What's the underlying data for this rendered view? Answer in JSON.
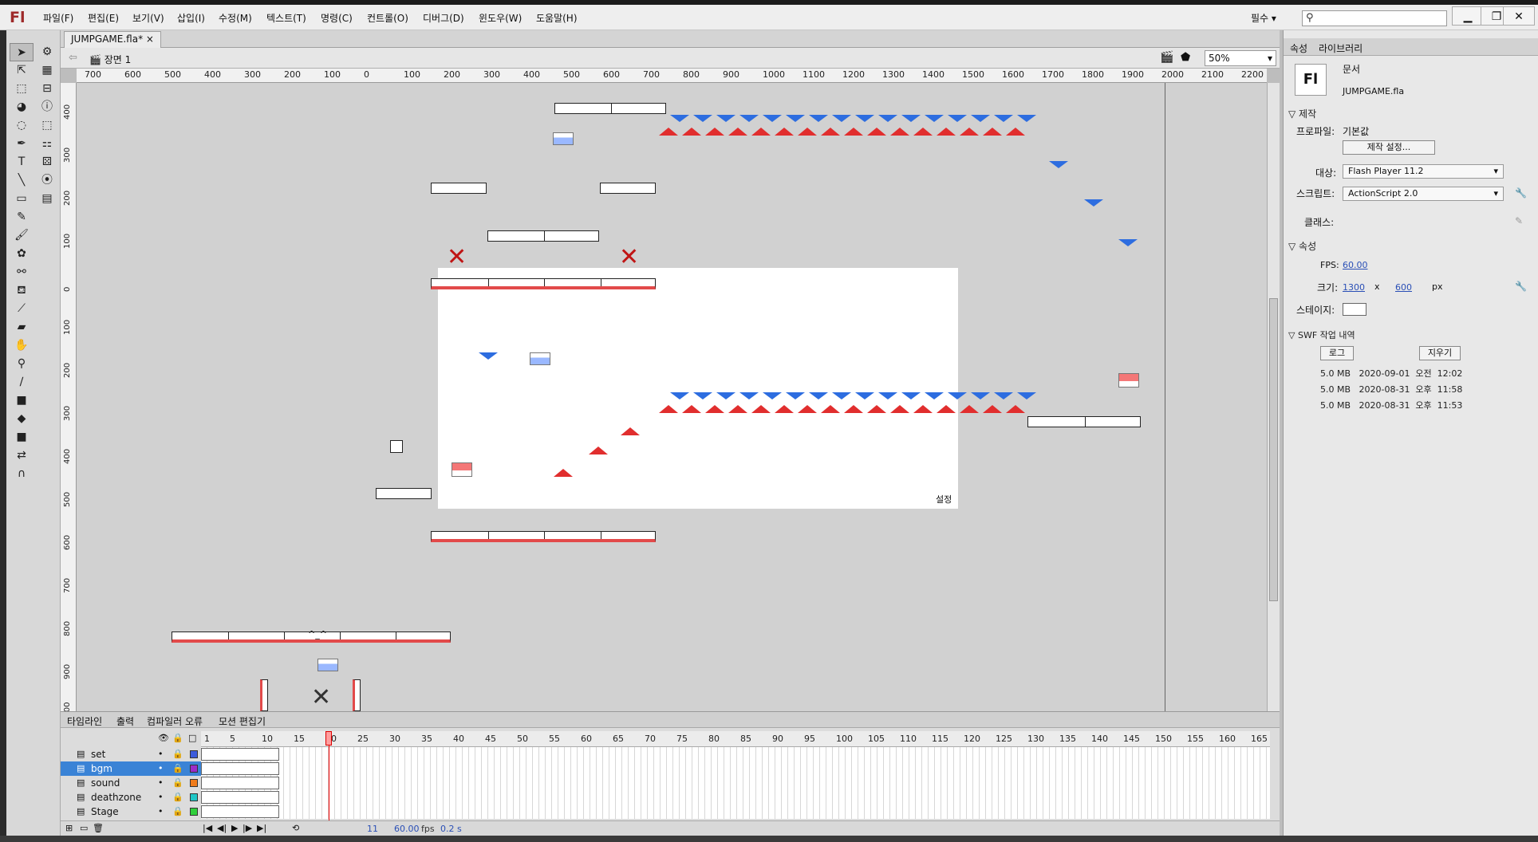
{
  "app": {
    "logo": "Fl"
  },
  "menu": [
    "파일(F)",
    "편집(E)",
    "보기(V)",
    "삽입(I)",
    "수정(M)",
    "텍스트(T)",
    "명령(C)",
    "컨트롤(O)",
    "디버그(D)",
    "윈도우(W)",
    "도움말(H)"
  ],
  "workspace_preset": "필수 ▾",
  "window_buttons": [
    "▁",
    "❐",
    "✕"
  ],
  "document": {
    "tab": "JUMPGAME.fla*",
    "tab_close": "×",
    "scene": "장면 1",
    "zoom": "50%"
  },
  "ruler_h": [
    "700",
    "600",
    "500",
    "400",
    "300",
    "200",
    "100",
    "0",
    "100",
    "200",
    "300",
    "400",
    "500",
    "600",
    "700",
    "800",
    "900",
    "1000",
    "1100",
    "1200",
    "1300",
    "1400",
    "1500",
    "1600",
    "1700",
    "1800",
    "1900",
    "2000",
    "2100",
    "2200"
  ],
  "ruler_v": [
    "400",
    "300",
    "200",
    "100",
    "0",
    "100",
    "200",
    "300",
    "400",
    "500",
    "600",
    "700",
    "800",
    "900",
    "1000"
  ],
  "stage_label": "설정",
  "smile_label": "^_^",
  "timeline": {
    "tabs": [
      "타임라인",
      "출력",
      "컴파일러 오류",
      "모션 편집기"
    ],
    "frame_numbers": [
      "1",
      "5",
      "10",
      "15",
      "20",
      "25",
      "30",
      "35",
      "40",
      "45",
      "50",
      "55",
      "60",
      "65",
      "70",
      "75",
      "80",
      "85",
      "90",
      "95",
      "100",
      "105",
      "110",
      "115",
      "120",
      "125",
      "130",
      "135",
      "140",
      "145",
      "150",
      "155",
      "160",
      "165"
    ],
    "layers": [
      {
        "name": "set",
        "color": "#3b5bdb",
        "selected": false
      },
      {
        "name": "bgm",
        "color": "#9b2cc9",
        "selected": true
      },
      {
        "name": "sound",
        "color": "#f07b1a",
        "selected": false
      },
      {
        "name": "deathzone",
        "color": "#1fc6c6",
        "selected": false
      },
      {
        "name": "Stage",
        "color": "#2fcf3b",
        "selected": false
      }
    ],
    "current_frame": "11",
    "fps": "60.00",
    "fps_unit": "fps",
    "time": "0.2 s"
  },
  "properties": {
    "tabs": [
      "속성",
      "라이브러리"
    ],
    "doc_icon": "Fl",
    "doc_type": "문서",
    "doc_file": "JUMPGAME.fla",
    "publish": {
      "section": "제작",
      "profile_label": "프로파일:",
      "profile_value": "기본값",
      "settings_button": "제작 설정...",
      "target_label": "대상:",
      "target_value": "Flash Player 11.2",
      "script_label": "스크립트:",
      "script_value": "ActionScript 2.0",
      "class_label": "클래스:"
    },
    "props": {
      "section": "속성",
      "fps_label": "FPS:",
      "fps_value": "60.00",
      "size_label": "크기:",
      "width": "1300",
      "x": "x",
      "height": "600",
      "unit": "px",
      "stage_label": "스테이지:"
    },
    "swf_history": {
      "section": "SWF 작업 내역",
      "log_button": "로그",
      "clear_button": "지우기",
      "entries": [
        "5.0 MB   2020-09-01  오전  12:02",
        "5.0 MB   2020-08-31  오후  11:58",
        "5.0 MB   2020-08-31  오후  11:53"
      ]
    }
  }
}
